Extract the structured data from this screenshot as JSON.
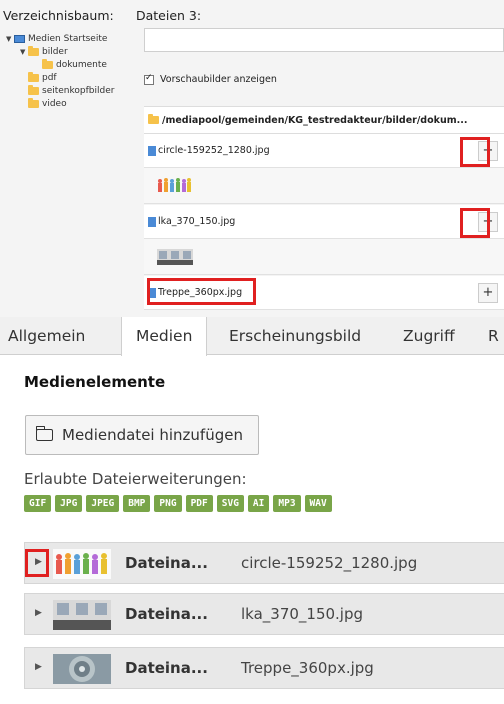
{
  "browser": {
    "tree_title": "Verzeichnisbaum:",
    "files_title": "Dateien 3:",
    "tree": {
      "root": "Medien Startseite",
      "items": [
        "bilder",
        "dokumente",
        "pdf",
        "seitenkopfbilder",
        "video"
      ]
    },
    "search_value": "",
    "show_previews_label": "Vorschaubilder anzeigen",
    "show_previews_checked": true,
    "path": "/mediapool/gemeinden/KG_testredakteur/bilder/dokum...",
    "files": [
      {
        "name": "circle-159252_1280.jpg",
        "add": "+"
      },
      {
        "name": "lka_370_150.jpg",
        "add": "+"
      },
      {
        "name": "Treppe_360px.jpg",
        "add": "+"
      }
    ]
  },
  "tabs": [
    "Allgemein",
    "Medien",
    "Erscheinungsbild",
    "Zugriff",
    "R"
  ],
  "active_tab": "Medien",
  "media": {
    "section_title": "Medienelemente",
    "add_button": "Mediendatei hinzufügen",
    "extensions_label": "Erlaubte Dateierweiterungen:",
    "extensions": [
      "GIF",
      "JPG",
      "JPEG",
      "BMP",
      "PNG",
      "PDF",
      "SVG",
      "AI",
      "MP3",
      "WAV"
    ],
    "items": [
      {
        "label": "Dateina...",
        "file": "circle-159252_1280.jpg"
      },
      {
        "label": "Dateina...",
        "file": "lka_370_150.jpg"
      },
      {
        "label": "Dateina...",
        "file": "Treppe_360px.jpg"
      }
    ]
  },
  "colors": {
    "highlight": "#e02020",
    "badge": "#79a548",
    "folder": "#f6c24a"
  }
}
